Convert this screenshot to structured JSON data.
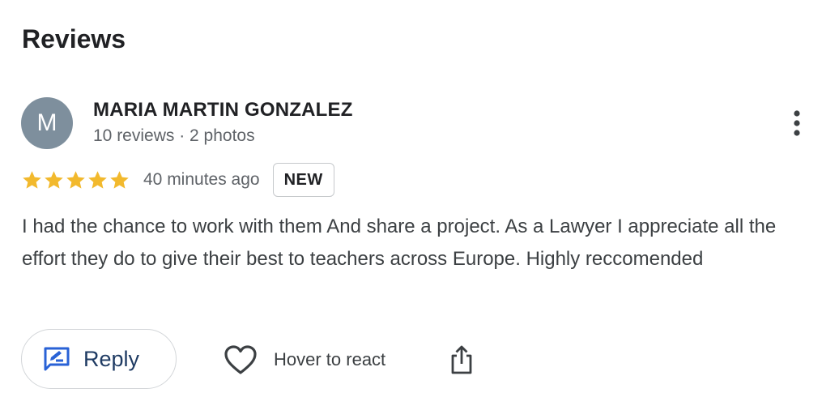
{
  "section": {
    "title": "Reviews"
  },
  "review": {
    "avatar_initial": "M",
    "author_name": "MARIA MARTIN GONZALEZ",
    "author_meta": "10 reviews · 2 photos",
    "rating": 5,
    "rating_max": 5,
    "time": "40 minutes ago",
    "badge": "NEW",
    "text": "I had the chance to work with them And share a project. As a Lawyer I appreciate all the effort they do to give their best to teachers across Europe. Highly reccomended"
  },
  "actions": {
    "reply_label": "Reply",
    "react_label": "Hover to react",
    "reply_icon": "reply-edit-icon",
    "react_icon": "heart-outline-icon",
    "share_icon": "share-icon",
    "more_icon": "more-vertical-icon"
  },
  "colors": {
    "star": "#f2b92d",
    "avatar_bg": "#7e8f9d",
    "reply_icon": "#2962d6",
    "reply_text": "#1f3b63"
  }
}
